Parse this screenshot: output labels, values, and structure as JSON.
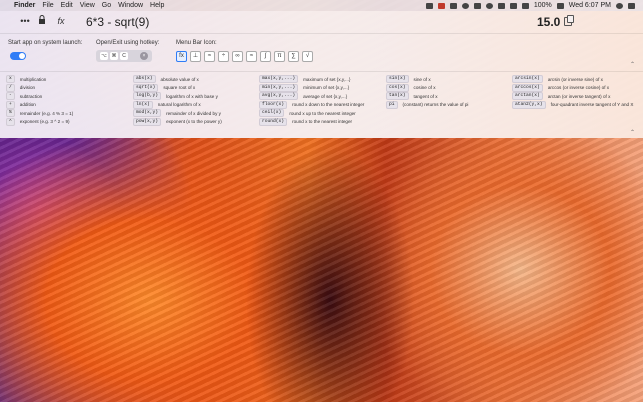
{
  "menubar": {
    "app": "Finder",
    "items": [
      "File",
      "Edit",
      "View",
      "Go",
      "Window",
      "Help"
    ],
    "battery": "100%",
    "clock": "Wed 6:07 PM"
  },
  "toolbar": {
    "more": "•••",
    "fx": "fx",
    "expression": "6*3 - sqrt(9)",
    "result": "15.0"
  },
  "settings": {
    "launch_label": "Start app on system launch:",
    "hotkey_label": "Open/Exit using hotkey:",
    "hotkey_keys": [
      "⌥",
      "⌘",
      "C"
    ],
    "menubar_icon_label": "Menu Bar Icon:",
    "menubar_icons": [
      "fx",
      "⊥",
      "≈",
      "÷",
      "∞",
      "≈",
      "∫",
      "π",
      "∑",
      "√"
    ]
  },
  "reference": {
    "operators": [
      {
        "code": "x",
        "desc": "multiplication"
      },
      {
        "code": "/",
        "desc": "division"
      },
      {
        "code": "-",
        "desc": "subtraction"
      },
      {
        "code": "+",
        "desc": "addition"
      },
      {
        "code": "%",
        "desc": "remainder (e.g. 4 % 3 = 1)"
      },
      {
        "code": "^",
        "desc": "exponent (e.g. 3 ^ 2 = 9)"
      }
    ],
    "basic": [
      {
        "code": "abs(x)",
        "desc": "absolute value of x"
      },
      {
        "code": "sqrt(x)",
        "desc": "square root of x"
      },
      {
        "code": "log(b,y)",
        "desc": "logarithm of x with base y"
      },
      {
        "code": "ln(x)",
        "desc": "natural logarithm of x"
      },
      {
        "code": "mod(x,y)",
        "desc": "remainder of x divided by y"
      },
      {
        "code": "pow(x,y)",
        "desc": "exponent (x to the power y)"
      }
    ],
    "sets": [
      {
        "code": "max(x,y,...)",
        "desc": "maximum of set {x,y,...}"
      },
      {
        "code": "min(x,y,...)",
        "desc": "minimum of set {x,y,...}"
      },
      {
        "code": "avg(x,y,...)",
        "desc": "average of set {x,y,...}"
      },
      {
        "code": "floor(x)",
        "desc": "round x down to the nearest integer"
      },
      {
        "code": "ceil(x)",
        "desc": "round x up to the nearest integer"
      },
      {
        "code": "round(x)",
        "desc": "round x to the nearest integer"
      }
    ],
    "trig": [
      {
        "code": "sin(x)",
        "desc": "sine of x"
      },
      {
        "code": "cos(x)",
        "desc": "cosine of x"
      },
      {
        "code": "tan(x)",
        "desc": "tangent of x"
      },
      {
        "code": "pi",
        "desc": "(constant) returns the value of pi"
      }
    ],
    "inverse": [
      {
        "code": "arcsin(x)",
        "desc": "arcsin (or inverse sine) of x"
      },
      {
        "code": "arccos(x)",
        "desc": "arccos (or inverse cosine) of x"
      },
      {
        "code": "arctan(x)",
        "desc": "arctan (or inverse tangent) of x"
      },
      {
        "code": "atan2(y,x)",
        "desc": "four-quadrant inverse tangent of Y and X"
      }
    ]
  },
  "colors": {
    "accent": "#2f7cf6"
  }
}
